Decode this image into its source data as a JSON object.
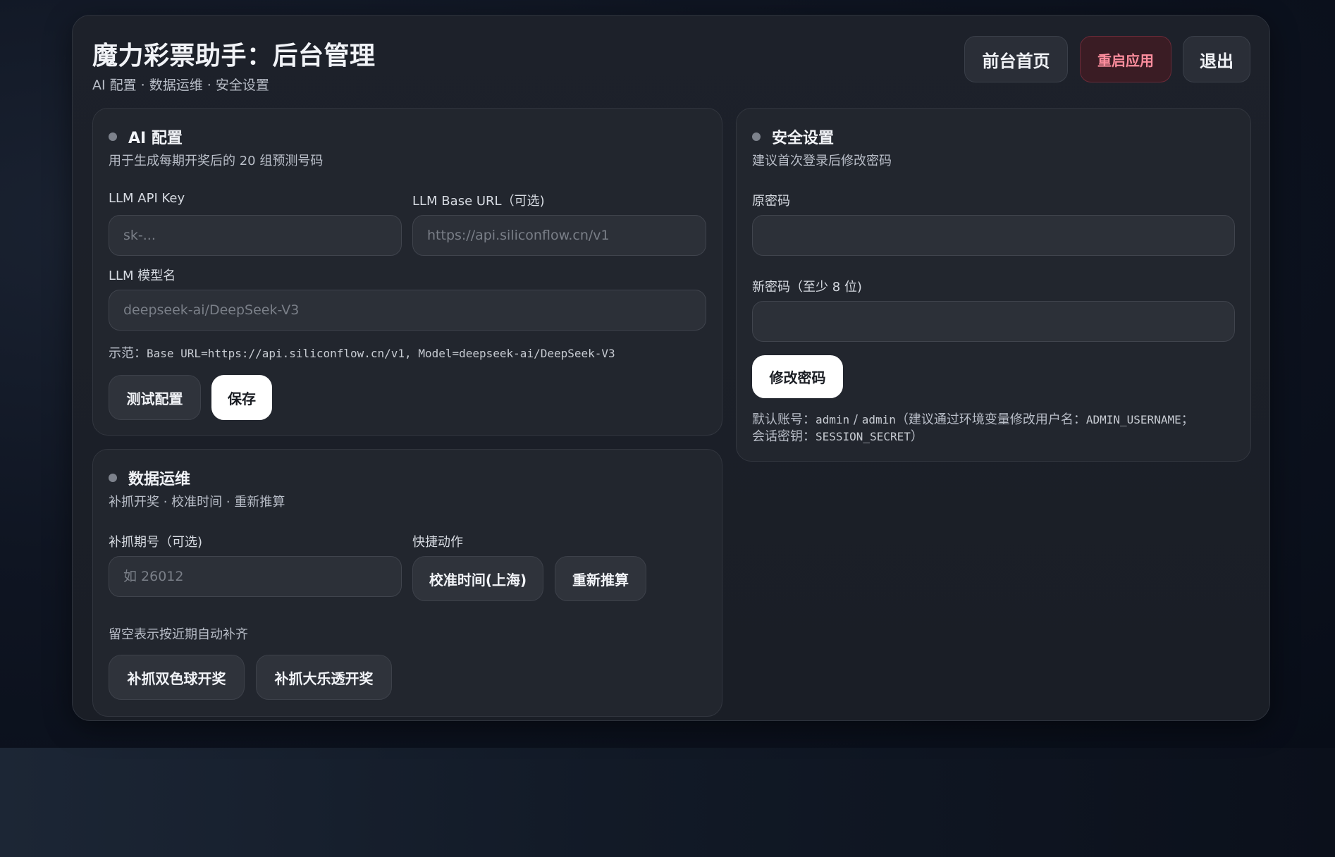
{
  "header": {
    "title": "魔力彩票助手：后台管理",
    "subtitle": "AI 配置 · 数据运维 · 安全设置",
    "buttons": {
      "home": "前台首页",
      "restart": "重启应用",
      "logout": "退出"
    }
  },
  "ai_config": {
    "title": "AI 配置",
    "description": "用于生成每期开奖后的 20 组预测号码",
    "api_key_label": "LLM API Key",
    "api_key_placeholder": "sk-...",
    "base_url_label": "LLM Base URL（可选)",
    "base_url_placeholder": "https://api.siliconflow.cn/v1",
    "model_label": "LLM 模型名",
    "model_placeholder": "deepseek-ai/DeepSeek-V3",
    "example_prefix": "示范：",
    "example_text": "Base URL=https://api.siliconflow.cn/v1, Model=deepseek-ai/DeepSeek-V3",
    "test_button": "测试配置",
    "save_button": "保存"
  },
  "security": {
    "title": "安全设置",
    "description": "建议首次登录后修改密码",
    "old_password_label": "原密码",
    "old_password_value": "",
    "new_password_label": "新密码（至少 8 位)",
    "new_password_value": "",
    "change_button": "修改密码",
    "note_line1_prefix": "默认账号：",
    "note_line1_user": "admin",
    "note_line1_sep": " / ",
    "note_line1_pass": "admin",
    "note_line1_mid": "（建议通过环境变量修改用户名：",
    "note_line1_var": "ADMIN_USERNAME",
    "note_line1_end": "；",
    "note_line2_prefix": "会话密钥：",
    "note_line2_var": "SESSION_SECRET",
    "note_line2_end": "）"
  },
  "data_ops": {
    "title": "数据运维",
    "description": "补抓开奖 · 校准时间 · 重新推算",
    "issue_label": "补抓期号（可选)",
    "issue_placeholder": "如 26012",
    "issue_hint": "留空表示按近期自动补齐",
    "quick_label": "快捷动作",
    "calibrate_button": "校准时间(上海)",
    "recalc_button": "重新推算",
    "fetch_ssq_button": "补抓双色球开奖",
    "fetch_dlt_button": "补抓大乐透开奖"
  }
}
